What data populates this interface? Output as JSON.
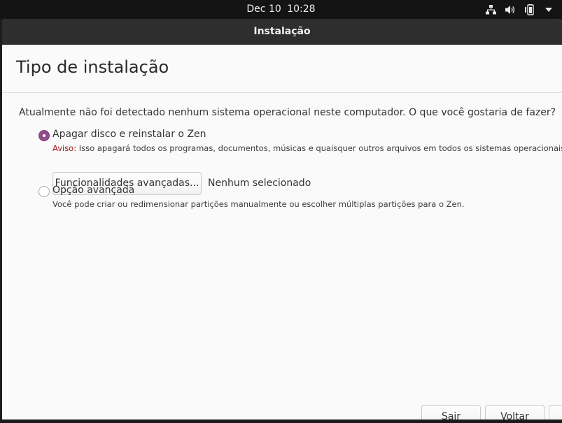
{
  "topbar": {
    "date": "Dec 10",
    "time": "10:28",
    "icons": [
      "network-icon",
      "volume-icon",
      "battery-icon",
      "menu-arrow-icon"
    ]
  },
  "window": {
    "title": "Instalação"
  },
  "page": {
    "title": "Tipo de instalação",
    "question": "Atualmente não foi detectado nenhum sistema operacional neste computador. O que você gostaria de fazer?"
  },
  "options": [
    {
      "label": "Apagar disco e reinstalar o Zen",
      "checked": true,
      "warning_label": "Aviso:",
      "note": " Isso apagará todos os programas, documentos, músicas e quaisquer outros arquivos em todos os sistemas operacionais."
    },
    {
      "label": "Opção avançada",
      "checked": false,
      "note": "Você pode criar ou redimensionar partições manualmente ou escolher múltiplas partições para o Zen."
    }
  ],
  "advanced": {
    "button_label": "Funcionalidades avançadas...",
    "status": "Nenhum selecionado"
  },
  "footer": {
    "quit_label": "Sair",
    "back_label": "Voltar"
  },
  "colors": {
    "accent": "#924d8b",
    "warning": "#a6131a",
    "titlebar": "#2e2e2e"
  }
}
